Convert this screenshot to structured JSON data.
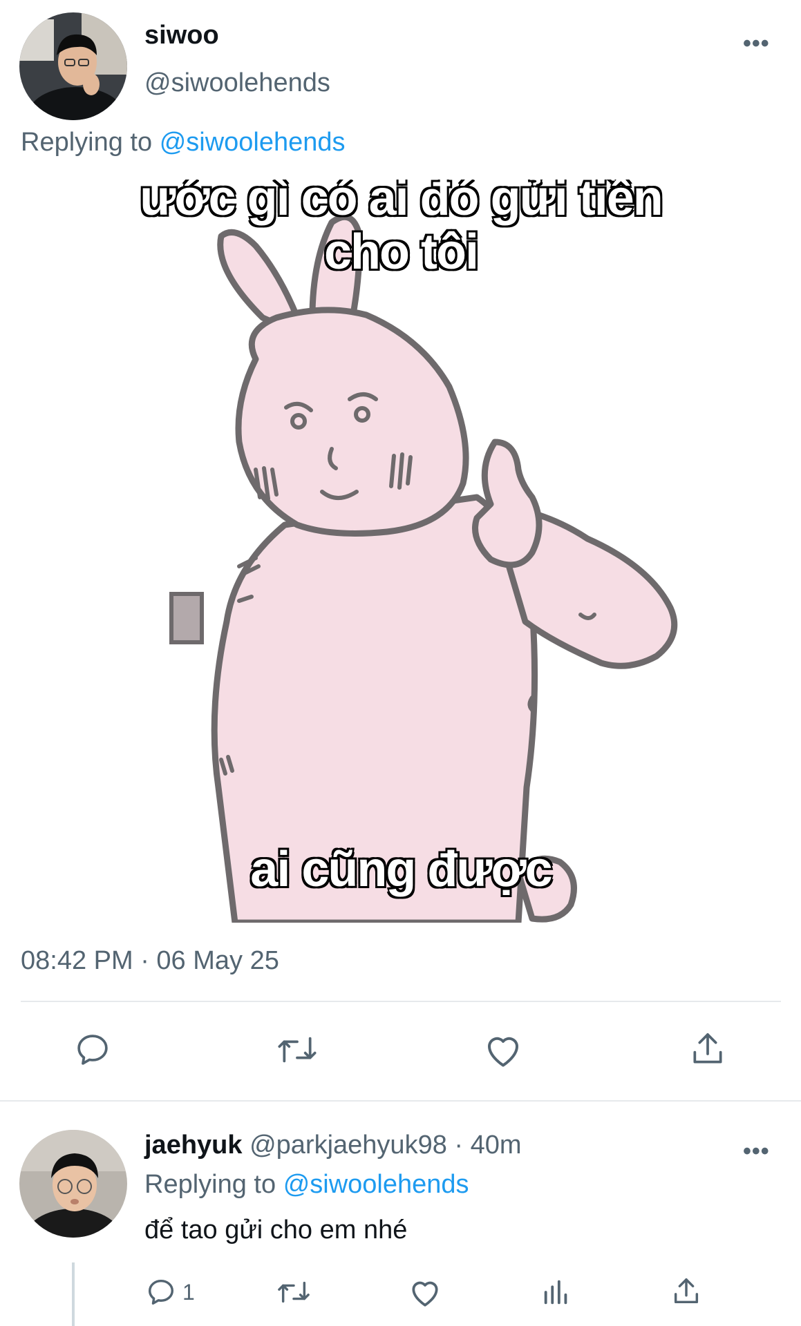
{
  "main_tweet": {
    "display_name": "siwoo",
    "handle": "@siwoolehends",
    "replying_prefix": "Replying to",
    "replying_to": "@siwoolehends",
    "meme": {
      "caption_top_line1": "ước gì có ai đó gửi tiền",
      "caption_top_line2": "cho tôi",
      "caption_bottom": "ai cũng được"
    },
    "timestamp": "08:42 PM · 06 May 25",
    "actions": [
      "reply-icon",
      "retweet-icon",
      "like-icon",
      "share-icon"
    ]
  },
  "reply_tweet": {
    "display_name": "jaehyuk",
    "meta": "@parkjaehyuk98 · 40m",
    "replying_prefix": "Replying to",
    "replying_to": "@siwoolehends",
    "text": "để tao gửi cho em nhé",
    "reply_count": "1",
    "actions": [
      "reply-icon",
      "retweet-icon",
      "like-icon",
      "views-icon",
      "share-icon"
    ]
  },
  "more_label": "•••",
  "colors": {
    "text": "#0f1419",
    "secondary": "#536471",
    "link": "#1d9bf0",
    "meme_pink": "#f6dde4",
    "meme_outline": "#6e6a6c"
  }
}
